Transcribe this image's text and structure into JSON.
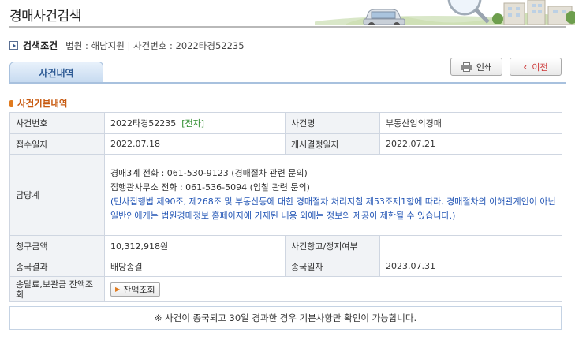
{
  "page": {
    "title": "경매사건검색"
  },
  "breadcrumb": {
    "title": "검색조건",
    "text": "법원 : 해남지원 | 사건번호 : 2022타경52235"
  },
  "buttons": {
    "print": "인쇄",
    "prev": "이전"
  },
  "tabs": [
    {
      "label": "사건내역"
    }
  ],
  "section": {
    "title": "사건기본내역"
  },
  "table": {
    "case_no_label": "사건번호",
    "case_no_value": "2022타경52235",
    "case_no_tag": "[전자]",
    "case_name_label": "사건명",
    "case_name_value": "부동산임의경매",
    "receipt_date_label": "접수일자",
    "receipt_date_value": "2022.07.18",
    "start_date_label": "개시결정일자",
    "start_date_value": "2022.07.21",
    "dept_label": "담당계",
    "dept_line1": "경매3계    전화 : 061-530-9123 (경매절차 관련 문의)",
    "dept_line2": "집행관사무소    전화 : 061-536-5094 (입찰 관련 문의)",
    "dept_notice": "(민사집행법 제90조, 제268조 및 부동산등에 대한 경매절차 처리지침 제53조제1항에 따라, 경매절차의 이해관계인이 아닌 일반인에게는 법원경매정보 홈페이지에 기재된 내용 외에는 정보의 제공이 제한될 수 있습니다.)",
    "claim_label": "청구금액",
    "claim_value": "10,312,918원",
    "appeal_label": "사건항고/정지여부",
    "appeal_value": "",
    "result_label": "종국결과",
    "result_value": "배당종결",
    "end_date_label": "종국일자",
    "end_date_value": "2023.07.31",
    "balance_label": "송달료,보관금 잔액조회",
    "balance_button": "잔액조회"
  },
  "notice": "※ 사건이 종국되고 30일 경과한 경우 기본사항만 확인이 가능합니다.",
  "icons": {
    "breadcrumb": "arrow-box-icon",
    "print": "printer-icon",
    "prev": "chevron-left-icon",
    "section": "bullet-icon",
    "balance": "arrow-right-icon"
  },
  "colors": {
    "tab_text": "#2d5a94",
    "section_title": "#c85a10",
    "notice_blue": "#2255b5",
    "tag_green": "#2a8a2a",
    "prev_red": "#cc3333"
  }
}
